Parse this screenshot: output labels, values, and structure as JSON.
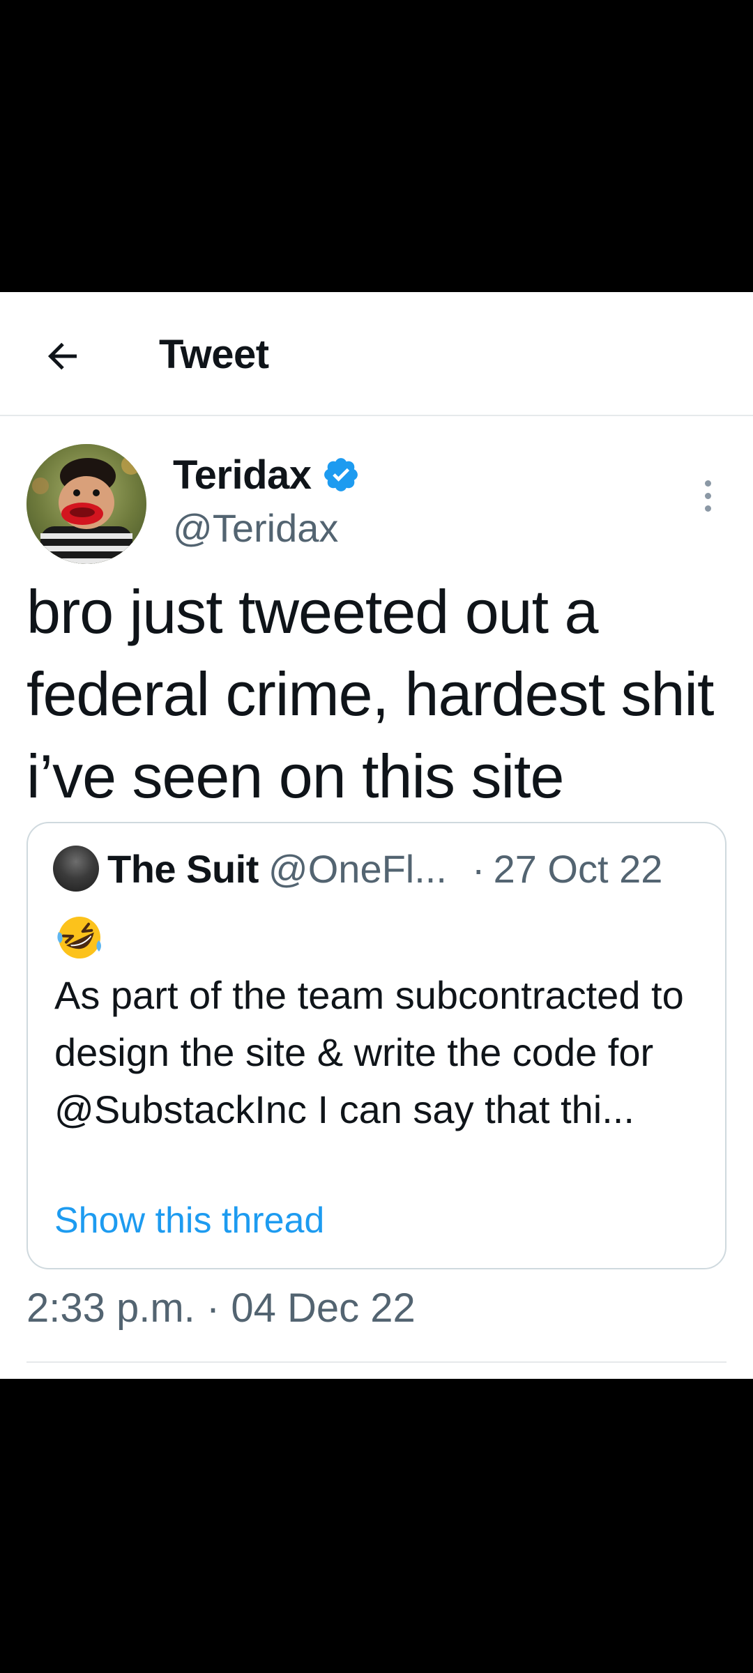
{
  "header": {
    "title": "Tweet",
    "back_icon": "arrow-left-icon"
  },
  "author": {
    "name": "Teridax",
    "handle": "@Teridax",
    "verified": true,
    "verified_color": "#1d9bf0"
  },
  "tweet": {
    "text": "bro just tweeted out a federal crime, hardest shit i’ve seen on this site",
    "timestamp": "2:33 p.m. · 04 Dec 22"
  },
  "quote": {
    "name": "The Suit",
    "handle": "@OneFl...",
    "separator": "·",
    "date": "27 Oct 22",
    "emoji": "rolling-on-floor-laughing-emoji",
    "text": "As part of the team subcontracted to design the site & write the code for @SubstackInc I can say that thi...",
    "thread_link": "Show this thread"
  },
  "colors": {
    "link": "#1d9bf0",
    "secondary_text": "#536471",
    "border": "#cfd9de"
  }
}
